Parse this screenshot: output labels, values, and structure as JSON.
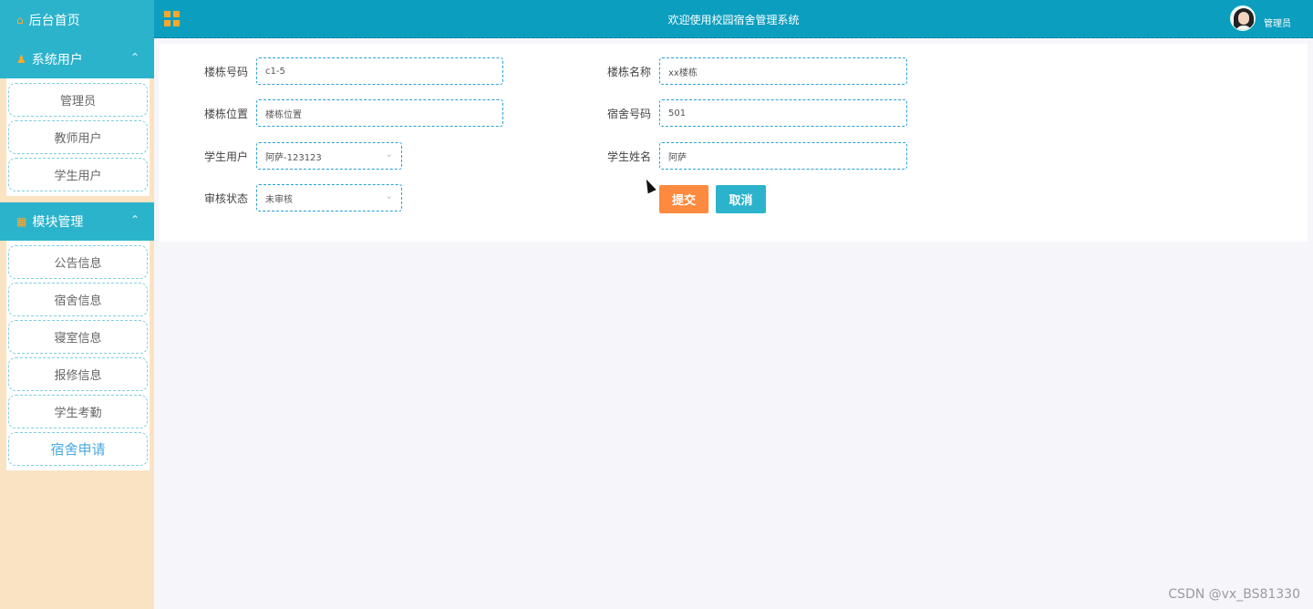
{
  "sidebar": {
    "home_label": "后台首页",
    "groups": [
      {
        "label": "系统用户",
        "items": [
          {
            "label": "管理员"
          },
          {
            "label": "教师用户"
          },
          {
            "label": "学生用户"
          }
        ]
      },
      {
        "label": "模块管理",
        "items": [
          {
            "label": "公告信息"
          },
          {
            "label": "宿舍信息"
          },
          {
            "label": "寝室信息"
          },
          {
            "label": "报修信息"
          },
          {
            "label": "学生考勤"
          },
          {
            "label": "宿舍申请",
            "active": true
          }
        ]
      }
    ]
  },
  "header": {
    "title": "欢迎使用校园宿舍管理系统",
    "user_name": "管理员"
  },
  "form": {
    "building_no": {
      "label": "楼栋号码",
      "value": "c1-5"
    },
    "building_name": {
      "label": "楼栋名称",
      "value": "xx楼栋"
    },
    "building_location": {
      "label": "楼栋位置",
      "value": "楼栋位置"
    },
    "dorm_no": {
      "label": "宿舍号码",
      "value": "501"
    },
    "student_user": {
      "label": "学生用户",
      "value": "阿萨-123123"
    },
    "student_name": {
      "label": "学生姓名",
      "value": "阿萨"
    },
    "review_status": {
      "label": "审核状态",
      "value": "未审核"
    },
    "submit_label": "提交",
    "cancel_label": "取消"
  },
  "colors": {
    "accent": "#0b9ebf",
    "sidebar_bg": "#fae3c3",
    "submit": "#fd8a3e",
    "cancel": "#2bb3cc",
    "icon": "#ffa72a"
  },
  "watermark": "CSDN @vx_BS81330"
}
